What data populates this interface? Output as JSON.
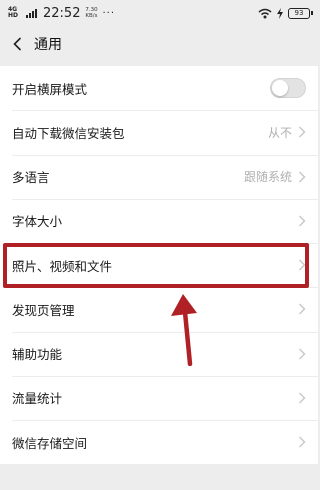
{
  "status_bar": {
    "network": "4G HD",
    "time": "22:52",
    "speed_value": "7.30",
    "speed_unit": "KB/s",
    "dots": "···",
    "battery": "93"
  },
  "nav": {
    "title": "通用"
  },
  "settings": [
    {
      "label": "开启横屏模式",
      "type": "toggle",
      "on": false
    },
    {
      "label": "自动下载微信安装包",
      "value": "从不"
    },
    {
      "label": "多语言",
      "value": "跟随系统"
    },
    {
      "label": "字体大小"
    },
    {
      "label": "照片、视频和文件",
      "highlighted": true
    },
    {
      "label": "发现页管理"
    },
    {
      "label": "辅助功能"
    },
    {
      "label": "流量统计"
    },
    {
      "label": "微信存储空间"
    }
  ],
  "annotation": {
    "color": "#b02126"
  }
}
